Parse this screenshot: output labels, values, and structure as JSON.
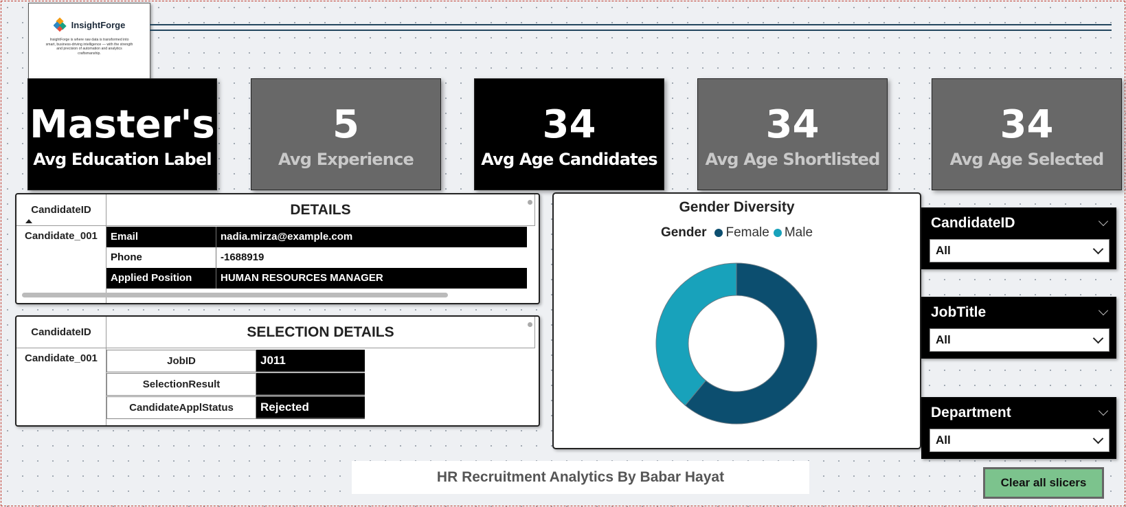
{
  "logo": {
    "name": "InsightForge",
    "tagline": "InsightForge is where raw data is transformed into smart, business-driving intelligence — with the strength and precision of automation and analytics craftsmanship."
  },
  "kpis": [
    {
      "value": "Master's",
      "label": "Avg Education Label",
      "style": "black"
    },
    {
      "value": "5",
      "label": "Avg Experience",
      "style": "grey"
    },
    {
      "value": "34",
      "label": "Avg Age Candidates",
      "style": "black"
    },
    {
      "value": "34",
      "label": "Avg Age Shortlisted",
      "style": "grey"
    },
    {
      "value": "34",
      "label": "Avg Age Selected",
      "style": "grey"
    }
  ],
  "details": {
    "id_header": "CandidateID",
    "title": "DETAILS",
    "candidate_id": "Candidate_001",
    "rows": [
      {
        "key": "Email",
        "value": "nadia.mirza@example.com"
      },
      {
        "key": "Phone",
        "value": "-1688919"
      },
      {
        "key": "Applied Position",
        "value": "HUMAN RESOURCES MANAGER"
      }
    ]
  },
  "selection": {
    "id_header": "CandidateID",
    "title": "SELECTION DETAILS",
    "candidate_id": "Candidate_001",
    "rows": [
      {
        "key": "JobID",
        "value": "J011"
      },
      {
        "key": "SelectionResult",
        "value": ""
      },
      {
        "key": "CandidateApplStatus",
        "value": "Rejected"
      }
    ]
  },
  "chart_data": {
    "type": "pie",
    "title": "Gender Diversity",
    "legend_title": "Gender",
    "categories": [
      "Female",
      "Male"
    ],
    "values": [
      61,
      39
    ],
    "colors": [
      "#0c4e6f",
      "#18a2bb"
    ],
    "donut": true,
    "legend_position": "top"
  },
  "slicers": [
    {
      "title": "CandidateID",
      "value": "All"
    },
    {
      "title": "JobTitle",
      "value": "All"
    },
    {
      "title": "Department",
      "value": "All"
    }
  ],
  "footer": {
    "title": "HR Recruitment Analytics By Babar Hayat",
    "clear_button": "Clear all slicers"
  }
}
